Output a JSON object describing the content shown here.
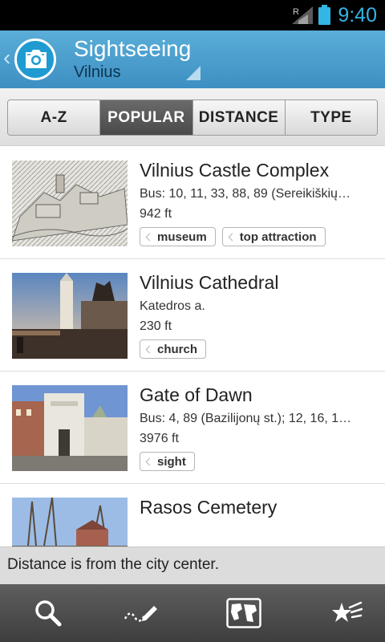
{
  "status": {
    "time": "9:40",
    "roaming": "R"
  },
  "header": {
    "title": "Sightseeing",
    "subtitle": "Vilnius",
    "back_icon": "chevron-left-icon",
    "app_icon": "camera-icon"
  },
  "tabs": [
    {
      "label": "A-Z",
      "active": false
    },
    {
      "label": "POPULAR",
      "active": true
    },
    {
      "label": "DISTANCE",
      "active": false
    },
    {
      "label": "TYPE",
      "active": false
    }
  ],
  "items": [
    {
      "name": "Vilnius Castle Complex",
      "address": "Bus: 10, 11, 33, 88, 89 (Sereikiškių…",
      "distance": "942 ft",
      "tags": [
        "museum",
        "top attraction"
      ]
    },
    {
      "name": "Vilnius Cathedral",
      "address": "Katedros a.",
      "distance": "230 ft",
      "tags": [
        "church"
      ]
    },
    {
      "name": "Gate of Dawn",
      "address": "Bus: 4, 89 (Bazilijonų st.); 12, 16, 1…",
      "distance": "3976 ft",
      "tags": [
        "sight"
      ]
    },
    {
      "name": "Rasos Cemetery",
      "address": "",
      "distance": "",
      "tags": []
    }
  ],
  "info_bar": {
    "text": "Distance is from the city center."
  },
  "bottom_bar": [
    {
      "icon": "search-icon"
    },
    {
      "icon": "pencil-icon"
    },
    {
      "icon": "map-icon"
    },
    {
      "icon": "favorites-stars-icon"
    }
  ],
  "colors": {
    "accent_blue": "#33b5e5",
    "action_bar": "#4a9dcc",
    "active_tab": "#555555"
  }
}
